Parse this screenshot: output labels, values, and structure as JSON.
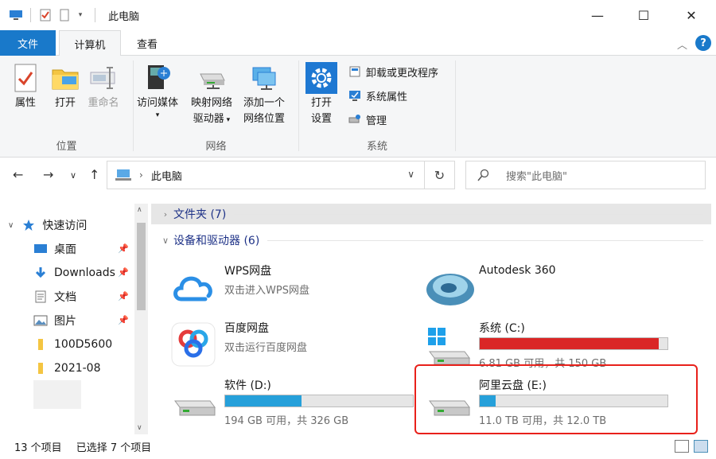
{
  "window": {
    "title": "此电脑",
    "minimize": "—",
    "maximize": "☐",
    "close": "✕"
  },
  "tabs": {
    "file": "文件",
    "computer": "计算机",
    "view": "查看"
  },
  "ribbon": {
    "location": {
      "label": "位置",
      "properties": "属性",
      "open": "打开",
      "rename": "重命名"
    },
    "network": {
      "label": "网络",
      "access_media": "访问媒体",
      "map_drive_1": "映射网络",
      "map_drive_2": "驱动器",
      "add_location_1": "添加一个",
      "add_location_2": "网络位置"
    },
    "system": {
      "label": "系统",
      "open_settings_1": "打开",
      "open_settings_2": "设置",
      "uninstall": "卸载或更改程序",
      "sys_props": "系统属性",
      "manage": "管理"
    }
  },
  "address": {
    "path": "此电脑",
    "search_placeholder": "搜索\"此电脑\""
  },
  "nav": {
    "quick_access": "快速访问",
    "items": [
      {
        "label": "桌面"
      },
      {
        "label": "Downloads"
      },
      {
        "label": "文档"
      },
      {
        "label": "图片"
      },
      {
        "label": "100D5600"
      },
      {
        "label": "2021-08"
      }
    ]
  },
  "content": {
    "folders_group": "文件夹 (7)",
    "devices_group": "设备和驱动器 (6)",
    "tiles": [
      {
        "name": "WPS网盘",
        "sub": "双击进入WPS网盘"
      },
      {
        "name": "Autodesk 360"
      },
      {
        "name": "百度网盘",
        "sub": "双击运行百度网盘"
      },
      {
        "name": "系统 (C:)",
        "sub": "6.81 GB 可用，共 150 GB",
        "used": 0.955,
        "color": "#da2626"
      },
      {
        "name": "软件 (D:)",
        "sub": "194 GB 可用，共 326 GB",
        "used": 0.405,
        "color": "#26a0da"
      },
      {
        "name": "阿里云盘 (E:)",
        "sub": "11.0 TB 可用，共 12.0 TB",
        "used": 0.083,
        "color": "#26a0da"
      }
    ]
  },
  "status": {
    "count": "13 个项目",
    "selected": "已选择 7 个项目"
  }
}
